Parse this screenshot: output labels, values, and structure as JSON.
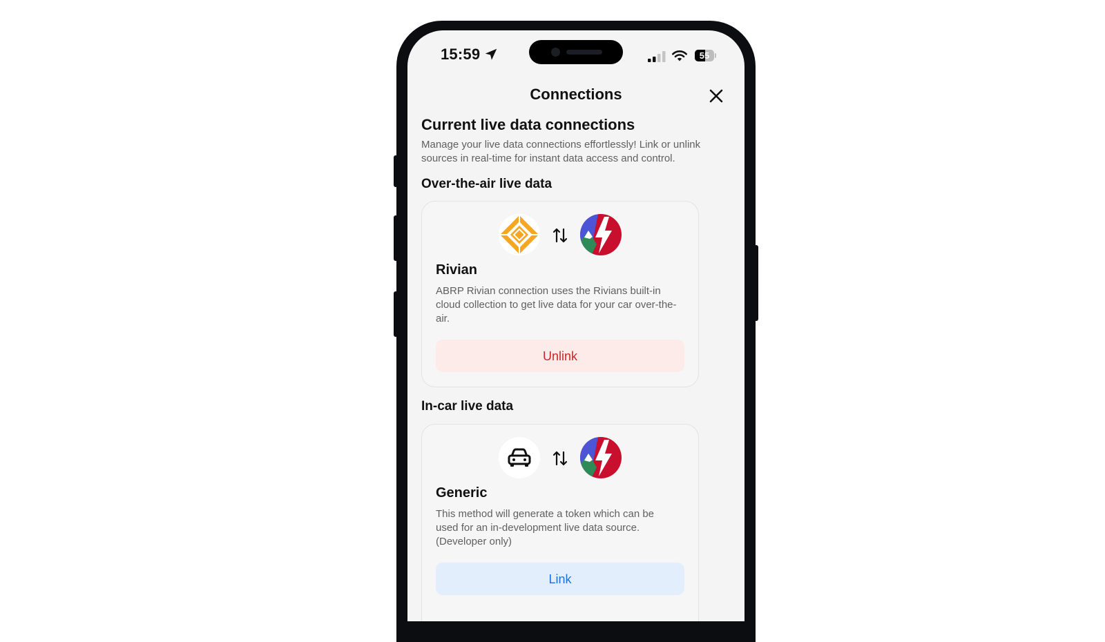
{
  "status_bar": {
    "time": "15:59",
    "battery_level": "55",
    "battery_percent": 55,
    "signal_bars_active": 2,
    "signal_bars_total": 4
  },
  "header": {
    "title": "Connections"
  },
  "intro": {
    "heading": "Current live data connections",
    "description": "Manage your live data connections effortlessly! Link or unlink sources in real-time for instant data access and control."
  },
  "sections": [
    {
      "heading": "Over-the-air live data",
      "card": {
        "title": "Rivian",
        "description": "ABRP Rivian connection uses the Rivians built-in cloud collection to get live data for your car over-the-air.",
        "button_label": "Unlink",
        "left_icon": "rivian-logo-icon",
        "right_icon": "abrp-logo-icon"
      }
    },
    {
      "heading": "In-car live data",
      "card": {
        "title": "Generic",
        "description": "This method will generate a token which can be used for an in-development live data source. (Developer only)",
        "button_label": "Link",
        "left_icon": "car-icon",
        "right_icon": "abrp-logo-icon"
      }
    }
  ],
  "colors": {
    "unlink_bg": "#fdebe9",
    "unlink_text": "#c62828",
    "link_bg": "#e3eefc",
    "link_text": "#1a73d8",
    "rivian_yellow": "#f5a623",
    "abrp_red": "#c8102e"
  }
}
